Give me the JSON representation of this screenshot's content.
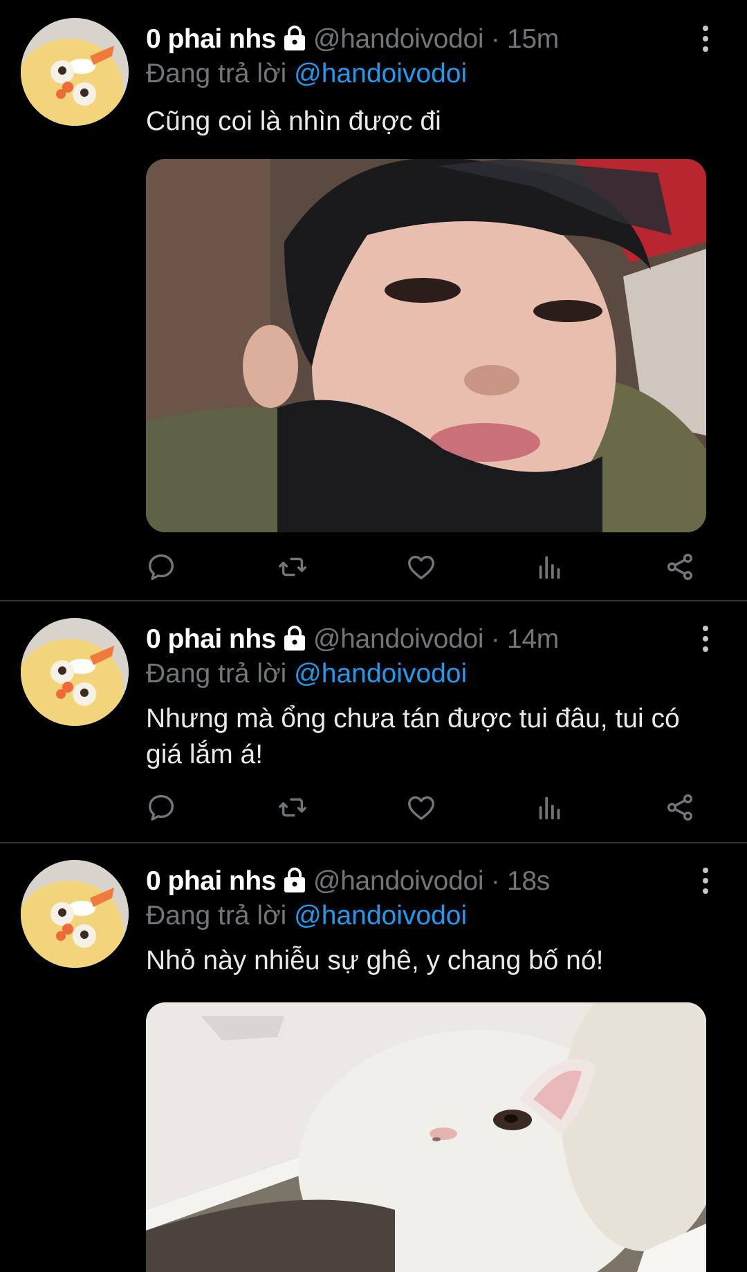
{
  "tweets": [
    {
      "display_name": "0 phai nhs",
      "handle": "@handoivodoi",
      "time": "15m",
      "reply_prefix": "Đang trả lời",
      "reply_to": "@handoivodoi",
      "text": "Cũng coi là nhìn được đi",
      "media": "selfie-photo"
    },
    {
      "display_name": "0 phai nhs",
      "handle": "@handoivodoi",
      "time": "14m",
      "reply_prefix": "Đang trả lời",
      "reply_to": "@handoivodoi",
      "text": "Nhưng mà ổng chưa tán được tui đâu, tui có giá lắm á!",
      "media": null
    },
    {
      "display_name": "0 phai nhs",
      "handle": "@handoivodoi",
      "time": "18s",
      "reply_prefix": "Đang trả lời",
      "reply_to": "@handoivodoi",
      "text": "Nhỏ này nhiễu sự ghê, y chang bố nó!",
      "media": "white-cat-photo"
    }
  ],
  "separator": "·",
  "icons": [
    "lock-icon",
    "more-icon",
    "reply-icon",
    "retweet-icon",
    "like-icon",
    "views-icon",
    "share-icon"
  ],
  "colors": {
    "background": "#000000",
    "secondary_text": "#71767b",
    "mention": "#1d9bf0",
    "divider": "#2f3336"
  }
}
